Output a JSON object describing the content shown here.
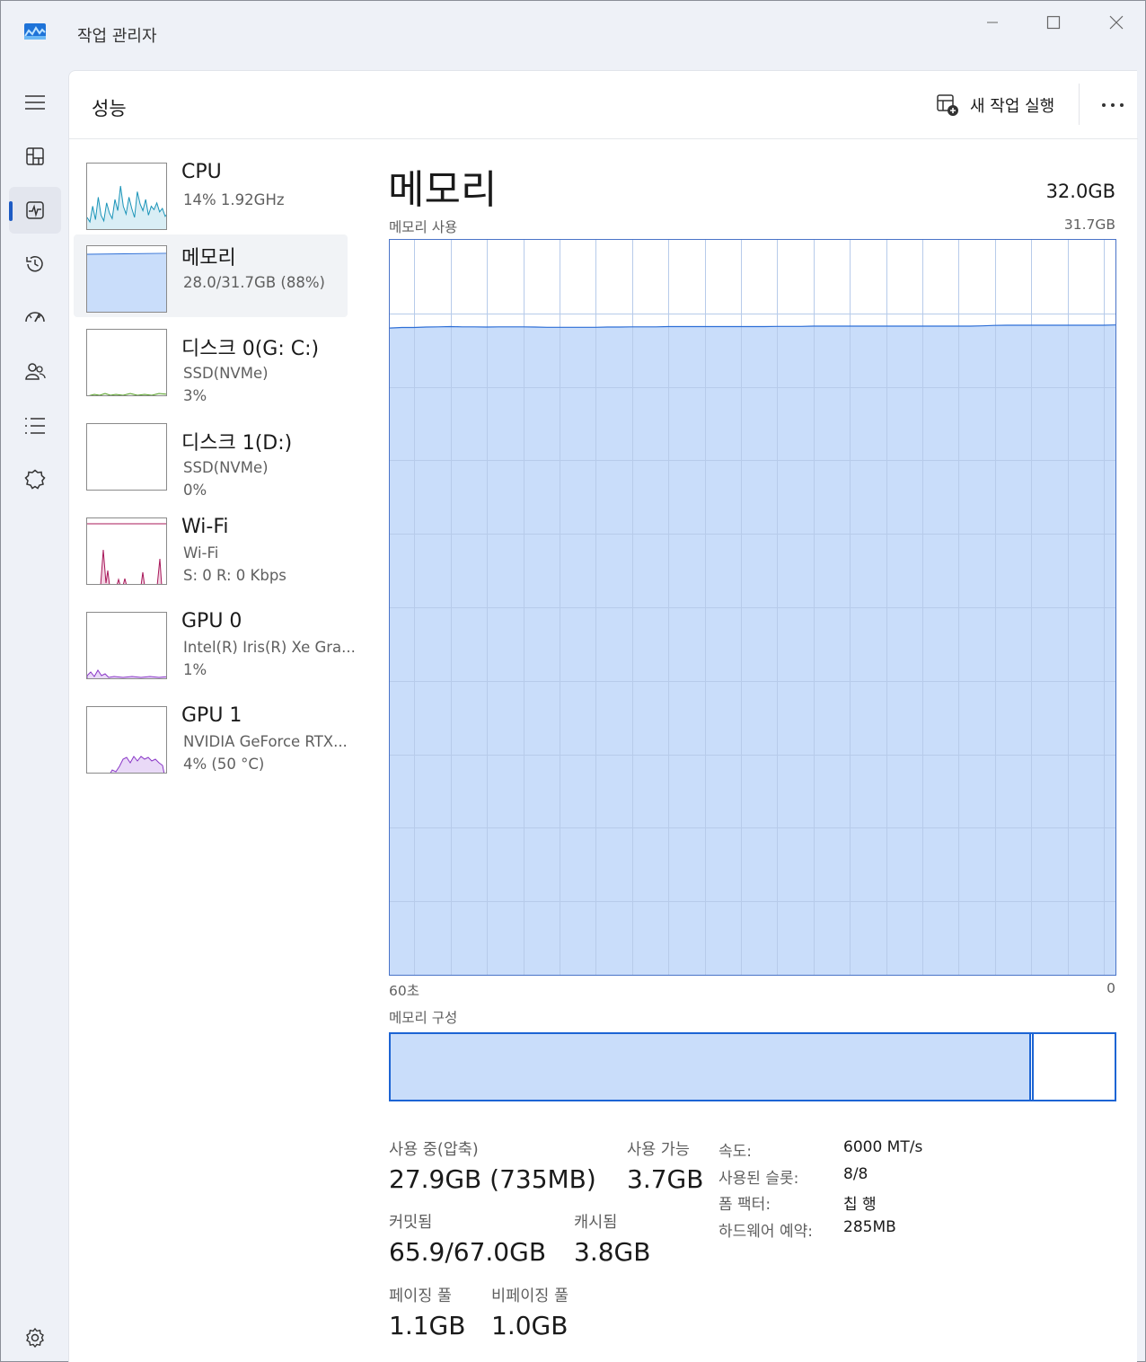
{
  "window": {
    "title": "작업 관리자"
  },
  "header": {
    "page_title": "성능",
    "run_task_label": "새 작업 실행"
  },
  "devices": [
    {
      "name": "CPU",
      "line1": "14%  1.92GHz",
      "line2": "",
      "color": "#1a94b8",
      "fill": "#d9eef5",
      "usage_percent": 14
    },
    {
      "name": "메모리",
      "line1": "28.0/31.7GB (88%)",
      "line2": "",
      "color": "#2e6fd6",
      "fill": "#c9ddfa",
      "usage_percent": 88
    },
    {
      "name": "디스크 0(G: C:)",
      "line1": "SSD(NVMe)",
      "line2": "3%",
      "color": "#4d9a1c",
      "fill": "#e3f2d6",
      "usage_percent": 3
    },
    {
      "name": "디스크 1(D:)",
      "line1": "SSD(NVMe)",
      "line2": "0%",
      "color": "#4d9a1c",
      "fill": "#e3f2d6",
      "usage_percent": 0
    },
    {
      "name": "Wi-Fi",
      "line1": "Wi-Fi",
      "line2": "S:  0  R:  0 Kbps",
      "color": "#a8185a",
      "fill": "#f3d3e2",
      "usage_percent": 0
    },
    {
      "name": "GPU 0",
      "line1": "Intel(R) Iris(R) Xe Gra...",
      "line2": "1%",
      "color": "#8a37c7",
      "fill": "#e9d9f7",
      "usage_percent": 1
    },
    {
      "name": "GPU 1",
      "line1": "NVIDIA GeForce RTX...",
      "line2": "4%  (50 °C)",
      "color": "#8a37c7",
      "fill": "#e9d9f7",
      "usage_percent": 4
    }
  ],
  "detail": {
    "title": "메모리",
    "total": "32.0GB",
    "usage_label": "메모리 사용",
    "graph_max_label": "31.7GB",
    "time_left_label": "60초",
    "time_right_label": "0",
    "composition_label": "메모리 구성",
    "composition": {
      "in_use_fraction": 0.885,
      "modified_fraction": 0.004
    },
    "stats": {
      "in_use_label": "사용 중(압축)",
      "in_use_value": "27.9GB (735MB)",
      "available_label": "사용 가능",
      "available_value": "3.7GB",
      "committed_label": "커밋됨",
      "committed_value": "65.9/67.0GB",
      "cached_label": "캐시됨",
      "cached_value": "3.8GB",
      "paged_label": "페이징 풀",
      "paged_value": "1.1GB",
      "nonpaged_label": "비페이징 풀",
      "nonpaged_value": "1.0GB"
    },
    "specs": {
      "speed_label": "속도:",
      "speed_value": "6000 MT/s",
      "slots_label": "사용된 슬롯:",
      "slots_value": "8/8",
      "form_label": "폼 팩터:",
      "form_value": "칩 행",
      "reserved_label": "하드웨어 예약:",
      "reserved_value": "285MB"
    }
  },
  "chart_data": {
    "type": "area",
    "title": "메모리 사용",
    "ylim": [
      0,
      31.7
    ],
    "x_range_seconds": [
      60,
      0
    ],
    "values_gb": [
      27.9,
      27.92,
      27.92,
      27.94,
      27.95,
      27.96,
      27.95,
      27.95,
      27.94,
      27.95,
      27.95,
      27.95,
      27.94,
      27.93,
      27.93,
      27.93,
      27.93,
      27.93,
      27.94,
      27.94,
      27.95,
      27.95,
      27.95,
      27.96,
      27.96,
      27.96,
      27.96,
      27.96,
      27.96,
      27.96,
      27.96,
      27.96,
      27.97,
      27.97,
      27.97,
      27.98,
      27.98,
      27.98,
      27.98,
      27.98,
      27.98,
      27.98,
      27.98,
      27.98,
      27.98,
      27.98,
      27.98,
      27.98,
      27.98,
      27.99,
      28.01,
      28.02,
      28.02,
      28.02,
      28.02,
      28.02,
      28.02,
      28.02,
      28.02,
      28.02,
      28.03
    ],
    "color": "#2e6fd6",
    "fill": "#c9ddfa"
  },
  "icons": {
    "app": "task-manager-icon",
    "nav": [
      "hamburger-menu-icon",
      "processes-icon",
      "performance-icon",
      "app-history-icon",
      "startup-apps-icon",
      "users-icon",
      "details-icon",
      "services-icon",
      "settings-icon"
    ]
  }
}
